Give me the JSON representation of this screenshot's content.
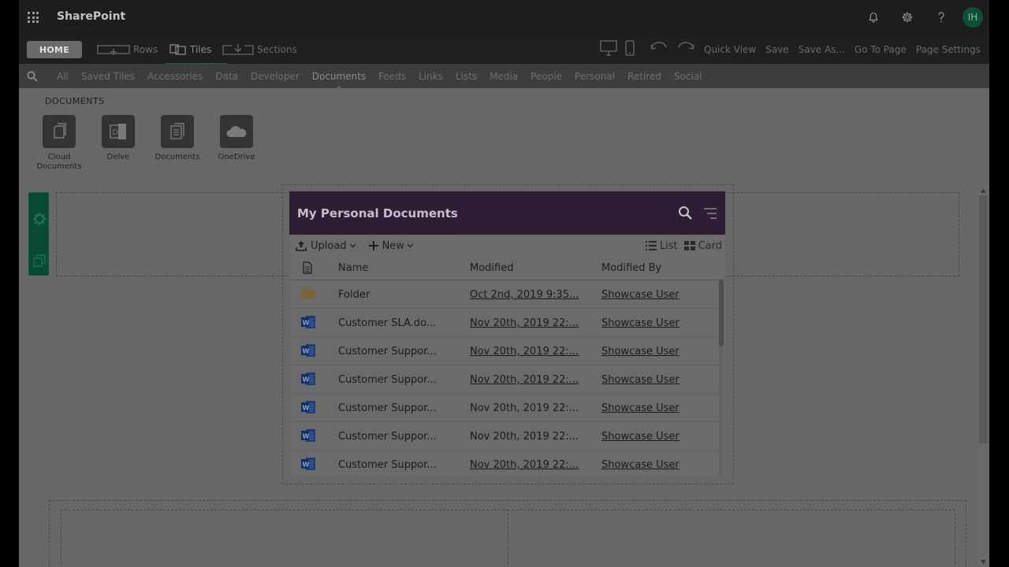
{
  "app": {
    "title": "SharePoint",
    "user_initials": "IH"
  },
  "toolbar": {
    "home_label": "HOME",
    "rows_label": "Rows",
    "tiles_label": "Tiles",
    "sections_label": "Sections",
    "quick_view": "Quick View",
    "save": "Save",
    "save_as": "Save As...",
    "go_to_page": "Go To Page",
    "page_settings": "Page Settings"
  },
  "categories": [
    {
      "label": "All"
    },
    {
      "label": "Saved Tiles"
    },
    {
      "label": "Accessories"
    },
    {
      "label": "Data"
    },
    {
      "label": "Developer"
    },
    {
      "label": "Documents"
    },
    {
      "label": "Feeds"
    },
    {
      "label": "Links"
    },
    {
      "label": "Lists"
    },
    {
      "label": "Media"
    },
    {
      "label": "People"
    },
    {
      "label": "Personal"
    },
    {
      "label": "Retired"
    },
    {
      "label": "Social"
    }
  ],
  "tray": {
    "title": "DOCUMENTS",
    "tiles": [
      {
        "label": "Cloud Documents",
        "icon": "cloud-documents-icon"
      },
      {
        "label": "Delve",
        "icon": "delve-icon"
      },
      {
        "label": "Documents",
        "icon": "documents-icon"
      },
      {
        "label": "OneDrive",
        "icon": "onedrive-icon"
      }
    ]
  },
  "widget": {
    "title": "My Personal Documents",
    "upload_label": "Upload",
    "new_label": "New",
    "list_label": "List",
    "card_label": "Card",
    "columns": {
      "name": "Name",
      "modified": "Modified",
      "modified_by": "Modified By"
    },
    "rows": [
      {
        "type": "folder",
        "name": "Folder",
        "modified": "Oct 2nd, 2019 9:35...",
        "modified_by": "Showcase User",
        "modified_link": true
      },
      {
        "type": "word",
        "name": "Customer SLA.do...",
        "modified": "Nov 20th, 2019 22:...",
        "modified_by": "Showcase User",
        "modified_link": true
      },
      {
        "type": "word",
        "name": "Customer Suppor...",
        "modified": "Nov 20th, 2019 22:...",
        "modified_by": "Showcase User",
        "modified_link": true
      },
      {
        "type": "word",
        "name": "Customer Suppor...",
        "modified": "Nov 20th, 2019 22:...",
        "modified_by": "Showcase User",
        "modified_link": true
      },
      {
        "type": "word",
        "name": "Customer Suppor...",
        "modified": "Nov 20th, 2019 22:...",
        "modified_by": "Showcase User",
        "modified_link": false
      },
      {
        "type": "word",
        "name": "Customer Suppor...",
        "modified": "Nov 20th, 2019 22:...",
        "modified_by": "Showcase User",
        "modified_link": false
      },
      {
        "type": "word",
        "name": "Customer Suppor...",
        "modified": "Nov 20th, 2019 22:...",
        "modified_by": "Showcase User",
        "modified_link": true
      }
    ]
  },
  "colors": {
    "widget_header": "#2d1e35",
    "side_tool": "#094a32",
    "avatar": "#0b5135",
    "word_blue": "#1a3e7a",
    "folder": "#7a6432"
  }
}
